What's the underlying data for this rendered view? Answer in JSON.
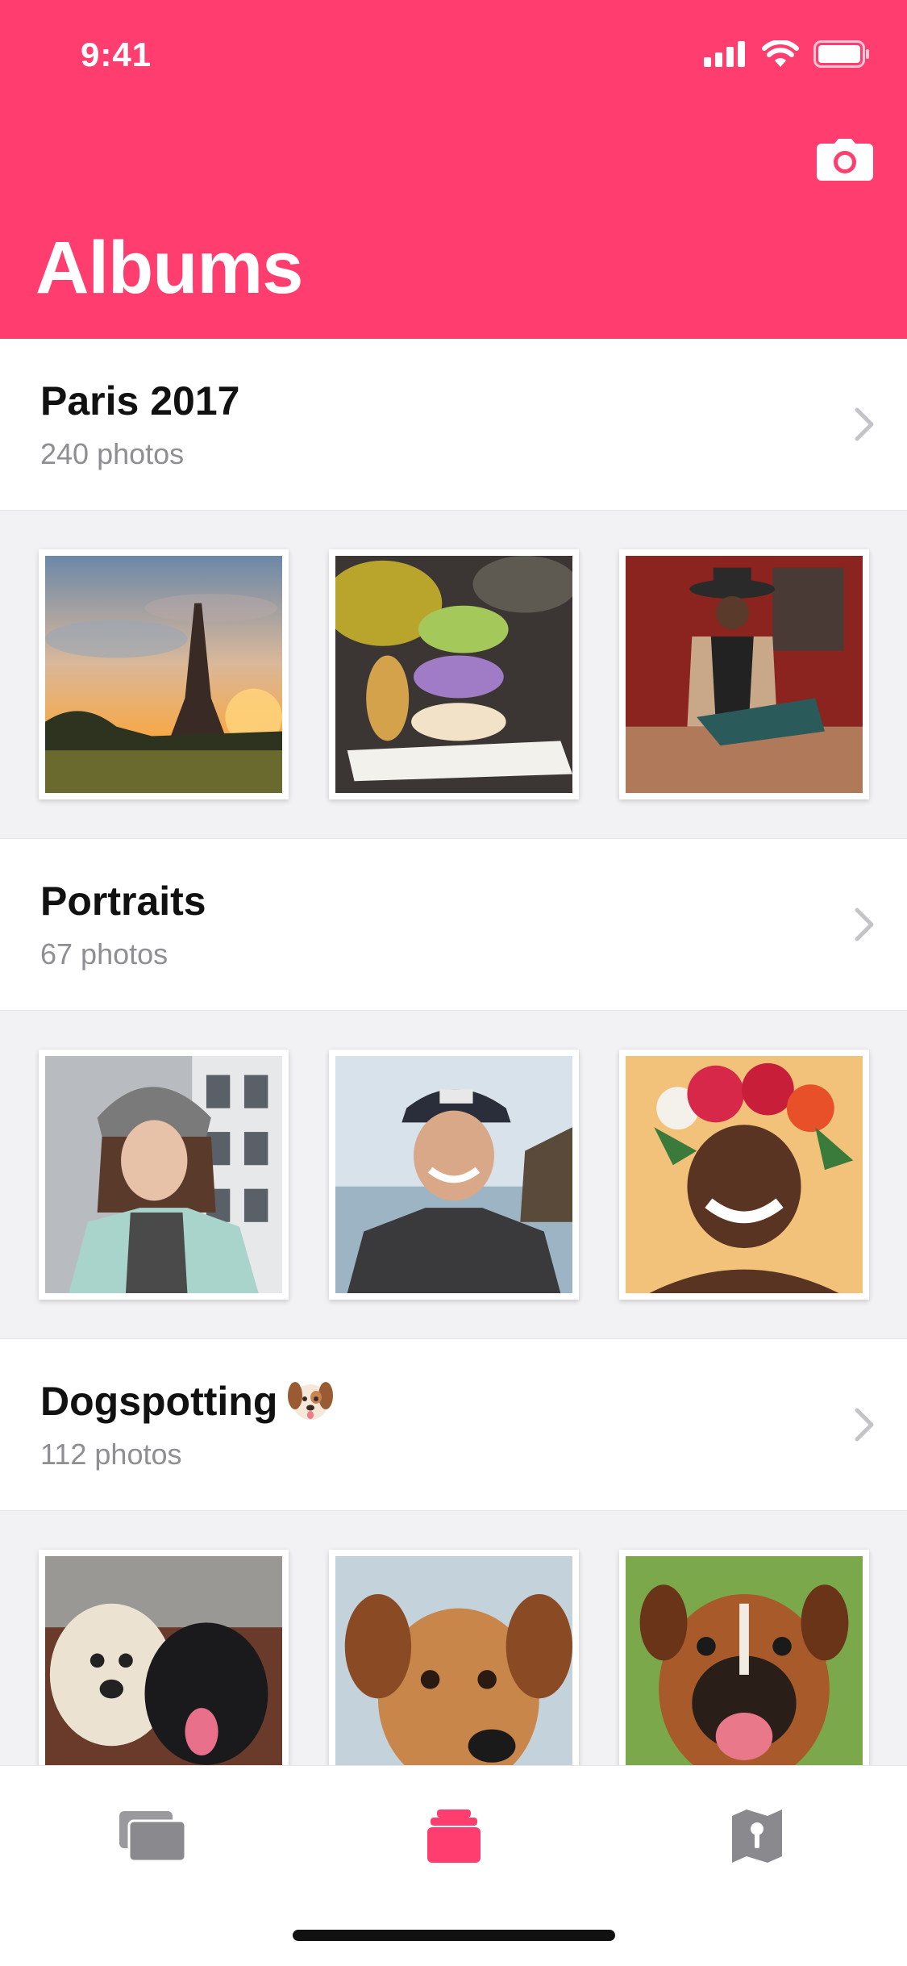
{
  "status_bar": {
    "time": "9:41"
  },
  "header": {
    "title": "Albums",
    "camera_icon": "camera-icon"
  },
  "colors": {
    "accent": "#ff3d6e",
    "background": "#f2f2f4",
    "secondary_text": "#8e8e93"
  },
  "albums": [
    {
      "name": "Paris 2017",
      "count": "240 photos",
      "thumbnails": [
        "eiffel-tower-sunset-photo",
        "macarons-stack-photo",
        "man-in-hat-sitting-photo"
      ]
    },
    {
      "name": "Portraits",
      "count": "67 photos",
      "thumbnails": [
        "woman-in-beanie-photo",
        "man-in-cap-smiling-photo",
        "woman-flower-crown-photo"
      ]
    },
    {
      "name": "Dogspotting",
      "emoji": "dog-face-emoji",
      "count": "112 photos",
      "thumbnails": [
        "two-dogs-photo",
        "brown-dog-photo",
        "boxer-dog-photo"
      ]
    }
  ],
  "tab_bar": {
    "tabs": [
      {
        "icon": "photos-stack-icon",
        "active": false
      },
      {
        "icon": "albums-icon",
        "active": true
      },
      {
        "icon": "map-icon",
        "active": false
      }
    ]
  }
}
